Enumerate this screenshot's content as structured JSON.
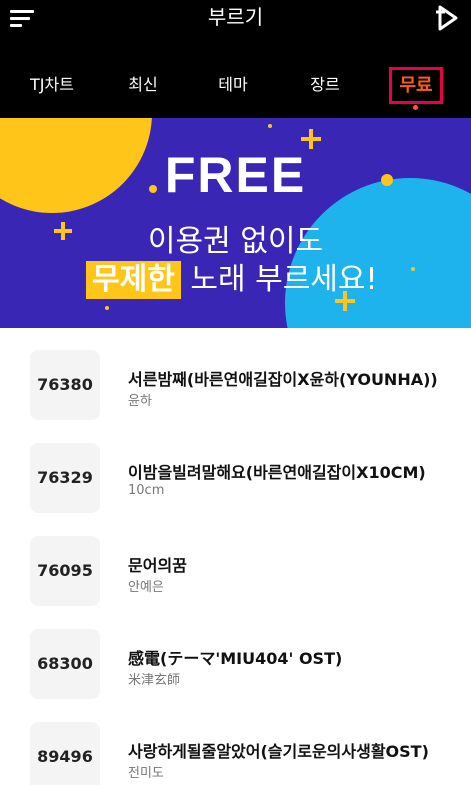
{
  "header": {
    "menu_icon": "hamburger-menu-icon",
    "title": "부르기",
    "brand_icon": "tj-media-play-icon"
  },
  "tabs": [
    {
      "label": "TJ차트"
    },
    {
      "label": "최신"
    },
    {
      "label": "테마"
    },
    {
      "label": "장르"
    },
    {
      "label": "무료",
      "active": true
    }
  ],
  "banner": {
    "headline": "FREE",
    "line1": "이용권 없이도",
    "highlight": "무제한",
    "line2_rest": "노래 부르세요!"
  },
  "songs": [
    {
      "number": "76380",
      "title": "서른밤째(바른연애길잡이X윤하(YOUNHA))",
      "artist": "윤하"
    },
    {
      "number": "76329",
      "title": "이밤을빌려말해요(바른연애길잡이X10CM)",
      "artist": "10cm"
    },
    {
      "number": "76095",
      "title": "문어의꿈",
      "artist": "안예은"
    },
    {
      "number": "68300",
      "title": "感電(テーマ'MIU404' OST)",
      "artist": "米津玄師"
    },
    {
      "number": "89496",
      "title": "사랑하게될줄알았어(슬기로운의사생활OST)",
      "artist": "전미도"
    }
  ],
  "colors": {
    "accent": "#ff5a1f",
    "active_border": "#e8004a",
    "banner_bg": "#3a26b4",
    "banner_yellow": "#ffc619",
    "banner_cyan": "#1fb3ee"
  }
}
